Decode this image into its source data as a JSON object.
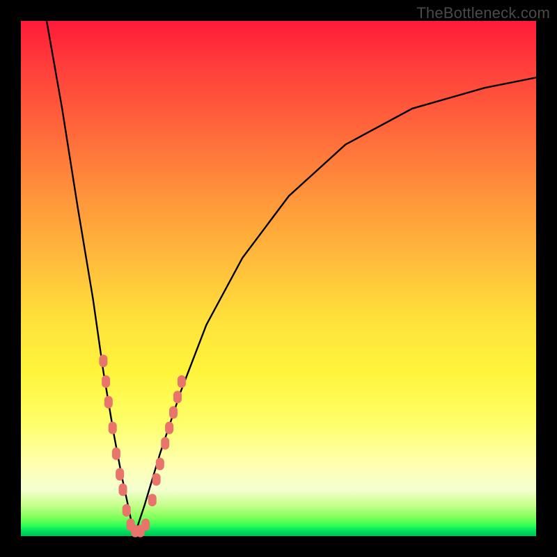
{
  "watermark": {
    "text": "TheBottleneck.com"
  },
  "colors": {
    "frame": "#000000",
    "curve_stroke": "#000000",
    "marker_fill": "#e9746b",
    "marker_stroke": "#e9746b"
  },
  "chart_data": {
    "type": "line",
    "title": "",
    "xlabel": "",
    "ylabel": "",
    "xlim": [
      0,
      100
    ],
    "ylim": [
      0,
      100
    ],
    "grid": false,
    "legend": false,
    "note": "Axes are unlabeled in the source image; values are read as percentages of the plot extent. y=0 is the bottom (green) and y=100 is the top (red). The V-shaped curve bottoms out near x≈22.",
    "series": [
      {
        "name": "left-branch",
        "x": [
          5,
          8,
          11,
          14,
          16,
          18,
          19.5,
          21,
          22
        ],
        "y": [
          100,
          83,
          64,
          46,
          32,
          20,
          12,
          5,
          0
        ]
      },
      {
        "name": "right-branch",
        "x": [
          22,
          24,
          27,
          31,
          36,
          43,
          52,
          63,
          76,
          90,
          100
        ],
        "y": [
          0,
          6,
          16,
          28,
          41,
          54,
          66,
          76,
          83,
          87,
          89
        ]
      }
    ],
    "markers": {
      "name": "highlighted-points",
      "note": "Pink rounded markers clustered near the trough of the V.",
      "points": [
        {
          "x": 16.0,
          "y": 34
        },
        {
          "x": 16.5,
          "y": 30
        },
        {
          "x": 17.0,
          "y": 26
        },
        {
          "x": 17.8,
          "y": 21
        },
        {
          "x": 18.5,
          "y": 16
        },
        {
          "x": 19.2,
          "y": 12
        },
        {
          "x": 19.8,
          "y": 9
        },
        {
          "x": 20.5,
          "y": 5
        },
        {
          "x": 21.3,
          "y": 2.2
        },
        {
          "x": 22.2,
          "y": 1.0
        },
        {
          "x": 23.2,
          "y": 1.0
        },
        {
          "x": 24.2,
          "y": 2.2
        },
        {
          "x": 25.5,
          "y": 7
        },
        {
          "x": 26.3,
          "y": 11
        },
        {
          "x": 27.0,
          "y": 14
        },
        {
          "x": 28.0,
          "y": 18
        },
        {
          "x": 28.8,
          "y": 21
        },
        {
          "x": 29.6,
          "y": 24
        },
        {
          "x": 30.4,
          "y": 27
        },
        {
          "x": 31.2,
          "y": 30
        }
      ]
    }
  }
}
